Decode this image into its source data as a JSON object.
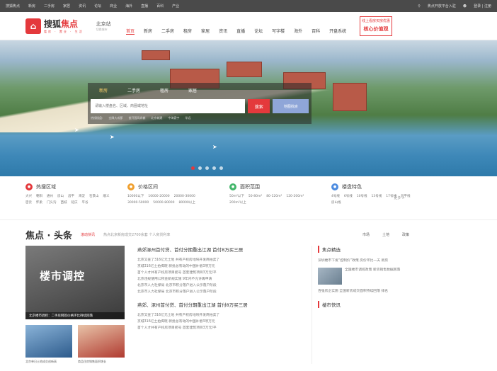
{
  "topbar": {
    "items": [
      "搜狐焦点",
      "新房",
      "二手房",
      "家居",
      "资讯",
      "论坛",
      "商业",
      "海外",
      "直播",
      "百科",
      "产业"
    ],
    "service": "焦点开放平台入驻",
    "login": "登录 | 注册"
  },
  "header": {
    "logo_main": "搜狐",
    "logo_accent": "焦点",
    "logo_sub": "看房 · 置业 · 生活",
    "city": "北京站",
    "city_sub": "切换城市",
    "nav": [
      "首页",
      "新房",
      "二手房",
      "租房",
      "家居",
      "资讯",
      "直播",
      "论坛",
      "写字楼",
      "海外",
      "百科",
      "开盘系统"
    ],
    "ad_top": "线上看房买房优惠",
    "ad_main": "核心价值观"
  },
  "hero": {
    "tabs": [
      "新房",
      "二手房",
      "租房",
      "家居"
    ],
    "search_placeholder": "请输入楼盘名、区域、商圈或地址",
    "search_btn": "搜索",
    "map_btn": "地图找房",
    "hot_label": "热搜楼盘:",
    "hot": [
      "金隅大成郡",
      "首开国风尚樾",
      "北京城建",
      "中海寰宇",
      "华远"
    ]
  },
  "filters": [
    {
      "title": "热搜区域",
      "color": "#e4393c",
      "items": [
        "大兴",
        "朝阳",
        "通州",
        "房山",
        "昌平",
        "海淀",
        "石景山",
        "顺义",
        "密云",
        "怀柔",
        "门头沟",
        "西城",
        "延庆",
        "平谷"
      ]
    },
    {
      "title": "价格区间",
      "color": "#f0a030",
      "items": [
        "10000以下",
        "10000-20000",
        "20000-30000",
        "30000-50000",
        "50000-80000",
        "80000以上"
      ]
    },
    {
      "title": "面积范围",
      "color": "#43b66b",
      "items": [
        "50m²以下",
        "50-80m²",
        "80-120m²",
        "120-200m²",
        "200m²以上"
      ]
    },
    {
      "title": "楼盘特色",
      "color": "#4d8ce0",
      "items": [
        "4号线",
        "6号线",
        "10号线",
        "13号线",
        "17号线",
        "昌平线",
        "房山线"
      ]
    }
  ],
  "more": "更多 >",
  "news": {
    "title": "焦点 · 头条",
    "tag": "滚动快讯",
    "sub": "热点北京新房成交2700余套  个人房贷利率",
    "tools": [
      "市场",
      "土地",
      "政策"
    ],
    "big_text": "楼市调控",
    "big_caption": "北京楼市调控：二手房网签价格环比持续回落",
    "thumb1": "北京单日土地成交创新高",
    "thumb2": "商品住房销售面积增长",
    "headline1": "燕郊涿州首付贷、首付分期重出江湖 首付8万买三居",
    "lines1": [
      "北京又查了316亿元土地 共有产权房地块开发商拍卖了",
      "京城316亿土拍揭晓 新批总有动的中国补偿3项万元",
      "首个人才共有产权房项目摇号 首套建筑项目3万元/平",
      "北京违规使用公积金新规实施 9年内不允许再申请",
      "北京市人力社保局 北京市积分落户进入公示落户阶段",
      "北京市人力社保局 北京市积分落户进入公示落户阶段"
    ],
    "headline2": "燕郊、涿州首付贷、首付分期重出江湖 首付8万买三居",
    "lines2": [
      "北京又查了316亿元土地 共有产权房地块开发商拍卖了",
      "京城316亿土拍揭晓 新批总有动的中国补偿3项万元",
      "首个人才共有产权房项目摇号 首套建筑项目3万元/平"
    ]
  },
  "right": {
    "head": "焦点精选",
    "text1": "深圳楼市下发“控制价”政策 房价环比一天 新房",
    "text2": "全国楼市调控政策 新房销售数据回落",
    "text3": "百强房企实施 全国新房成交面积持续回落 排名",
    "head2": "楼市快讯"
  }
}
